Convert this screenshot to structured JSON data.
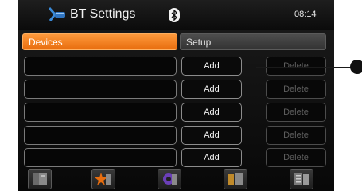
{
  "header": {
    "title": "BT Settings",
    "time": "08:14",
    "logo_icon": "bluetooth-phone-icon",
    "status_icon": "bluetooth-icon"
  },
  "tabs": [
    {
      "label": "Devices",
      "active": true
    },
    {
      "label": "Setup",
      "active": false
    }
  ],
  "device_rows": [
    {
      "device": "",
      "add_label": "Add",
      "delete_label": "Delete"
    },
    {
      "device": "",
      "add_label": "Add",
      "delete_label": "Delete"
    },
    {
      "device": "",
      "add_label": "Add",
      "delete_label": "Delete"
    },
    {
      "device": "",
      "add_label": "Add",
      "delete_label": "Delete"
    },
    {
      "device": "",
      "add_label": "Add",
      "delete_label": "Delete"
    }
  ],
  "toolbar": [
    {
      "icon": "phonebook-icon"
    },
    {
      "icon": "favorites-star-icon"
    },
    {
      "icon": "settings-gear-icon"
    },
    {
      "icon": "call-list-icon"
    },
    {
      "icon": "messages-icon"
    }
  ],
  "colors": {
    "accent": "#f27d1c",
    "background": "#0d0d0d",
    "text": "#f2f2f2",
    "disabled_text": "#5f5f5f"
  }
}
